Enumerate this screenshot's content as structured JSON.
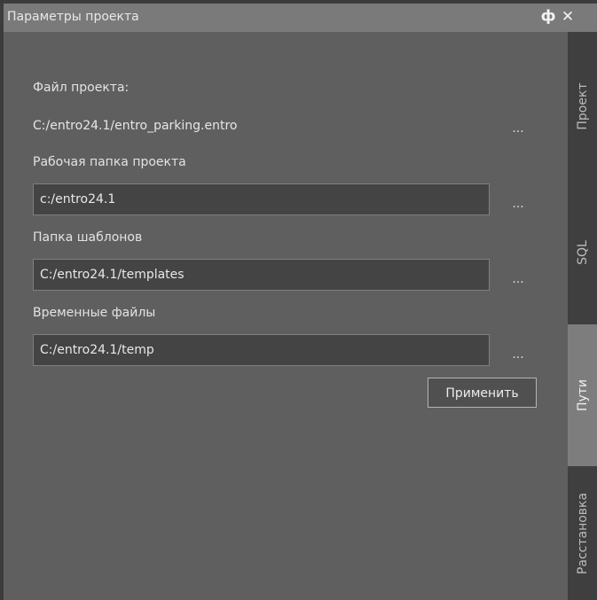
{
  "window": {
    "title": "Параметры проекта",
    "pin_glyph": "ф",
    "close_glyph": "✕"
  },
  "project": {
    "file_label": "Файл проекта:",
    "file_path": "C:/entro24.1/entro_parking.entro",
    "file_browse": "...",
    "workdir_label": "Рабочая папка проекта",
    "workdir_value": "c:/entro24.1",
    "workdir_browse": "...",
    "templates_label": "Папка шаблонов",
    "templates_value": "C:/entro24.1/templates",
    "templates_browse": "...",
    "temp_label": "Временные файлы",
    "temp_value": "C:/entro24.1/temp",
    "temp_browse": "...",
    "apply_label": "Применить"
  },
  "tabs": [
    {
      "label": "Проект",
      "active": false
    },
    {
      "label": "SQL",
      "active": false
    },
    {
      "label": "Пути",
      "active": true
    },
    {
      "label": "Расстановка",
      "active": false
    }
  ],
  "colors": {
    "panel_bg": "#5f5f5f",
    "titlebar_bg": "#7a7a7a",
    "field_bg": "#444444",
    "tabbar_bg": "#3f3f3f",
    "active_tab_bg": "#7d7d7d"
  }
}
